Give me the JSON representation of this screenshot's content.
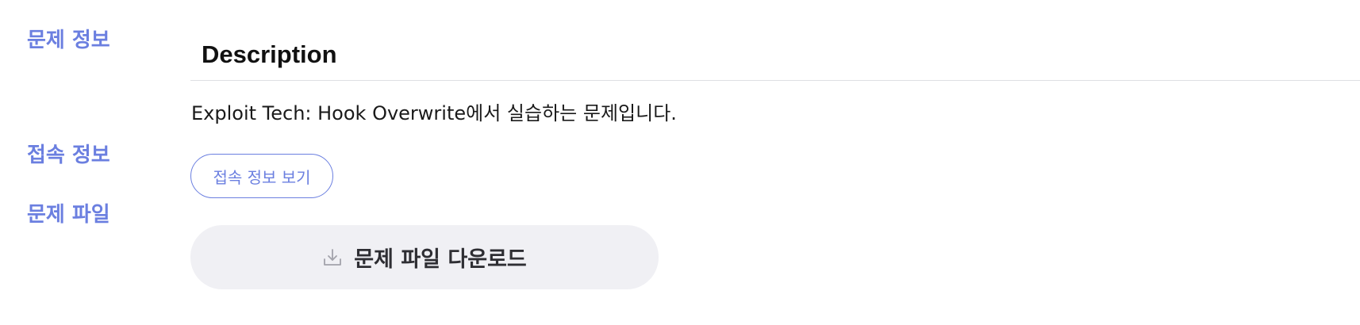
{
  "sections": {
    "problem_info": "문제 정보",
    "access_info": "접속 정보",
    "problem_file": "문제 파일"
  },
  "description": {
    "heading": "Description",
    "text": "Exploit Tech: Hook Overwrite에서 실습하는 문제입니다."
  },
  "access": {
    "button_label": "접속 정보 보기"
  },
  "file": {
    "download_label": "문제 파일 다운로드",
    "icon": "download-icon"
  },
  "colors": {
    "accent": "#6b7fe0",
    "download_bg": "#f0f0f4",
    "divider": "#dedfe3"
  }
}
